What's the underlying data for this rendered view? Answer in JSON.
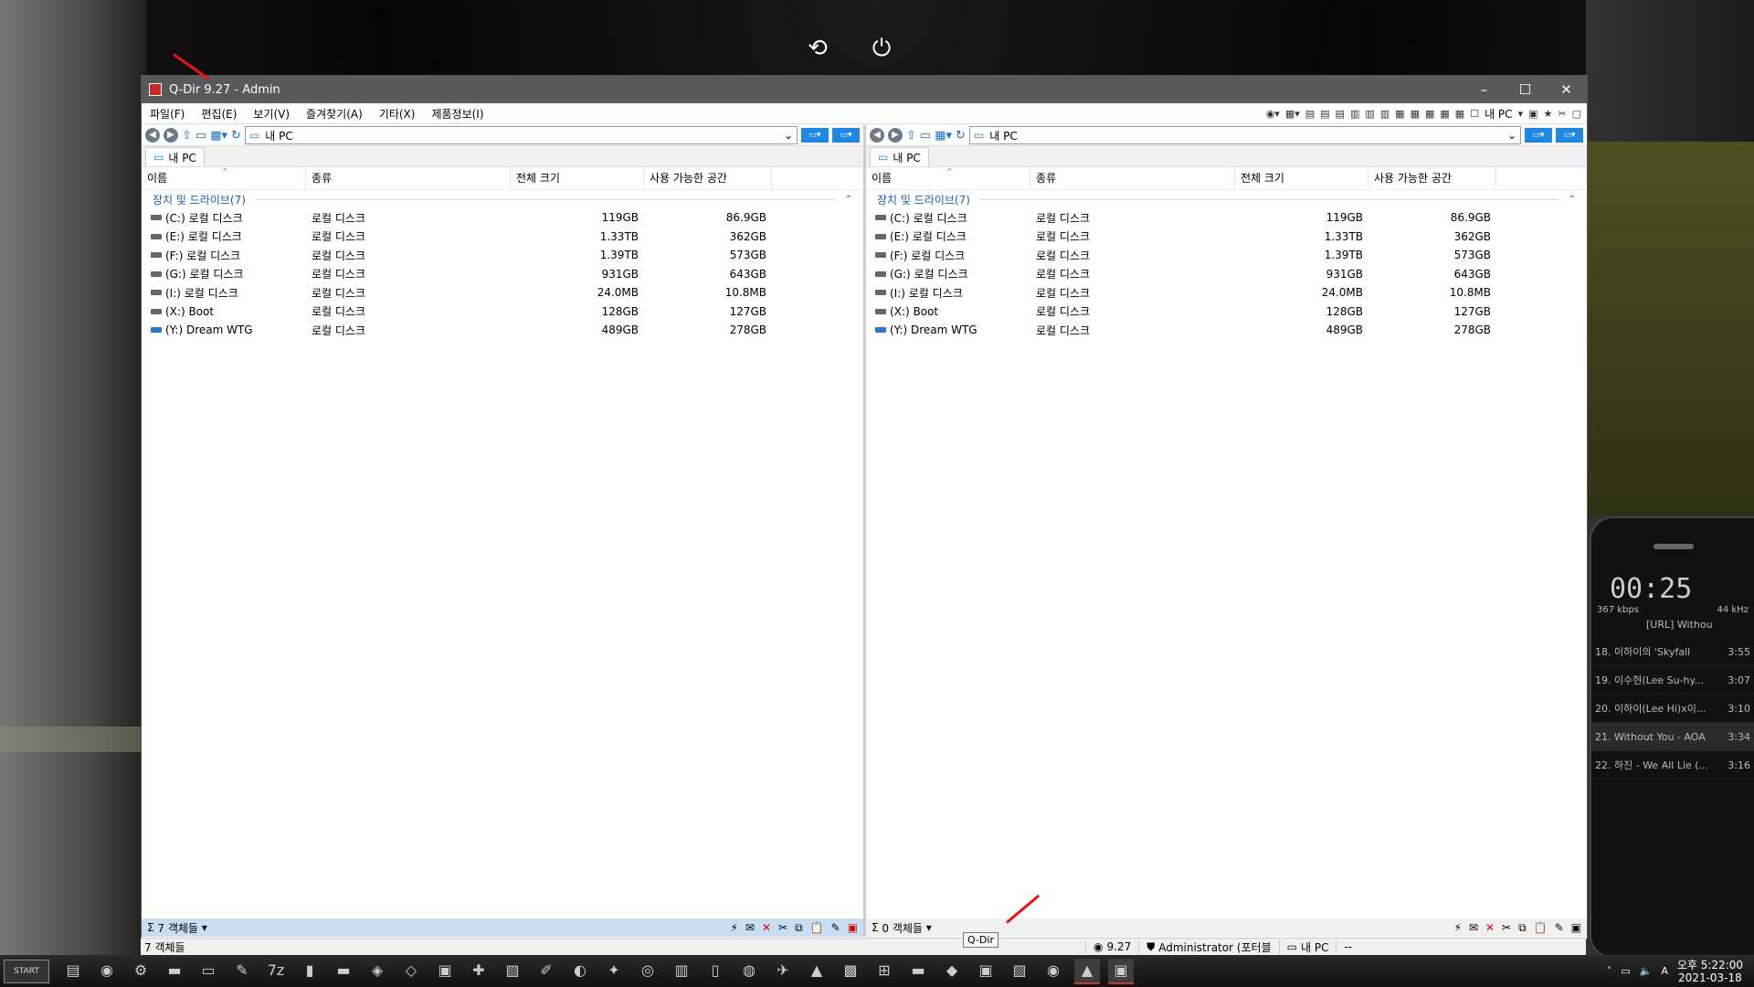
{
  "top_icons": {
    "restart": "⟲",
    "power": "⏻"
  },
  "window": {
    "title": "Q-Dir 9.27 - Admin",
    "controls": {
      "minimize": "–",
      "maximize": "☐",
      "close": "✕"
    },
    "menu": [
      "파일(F)",
      "편집(E)",
      "보기(V)",
      "즐겨찾기(A)",
      "기타(X)",
      "제품정보(I)"
    ],
    "menu_right_location": "내 PC"
  },
  "left_pane": {
    "address": "내 PC",
    "tab": "내 PC",
    "columns": [
      "이름",
      "종류",
      "전체 크기",
      "사용 가능한 공간"
    ],
    "group": "장치 및 드라이브(7)",
    "rows": [
      {
        "name": "(C:) 로컬 디스크",
        "type": "로컬 디스크",
        "total": "119GB",
        "free": "86.9GB"
      },
      {
        "name": "(E:) 로컬 디스크",
        "type": "로컬 디스크",
        "total": "1.33TB",
        "free": "362GB"
      },
      {
        "name": "(F:) 로컬 디스크",
        "type": "로컬 디스크",
        "total": "1.39TB",
        "free": "573GB"
      },
      {
        "name": "(G:) 로컬 디스크",
        "type": "로컬 디스크",
        "total": "931GB",
        "free": "643GB"
      },
      {
        "name": "(I:) 로컬 디스크",
        "type": "로컬 디스크",
        "total": "24.0MB",
        "free": "10.8MB"
      },
      {
        "name": "(X:) Boot",
        "type": "로컬 디스크",
        "total": "128GB",
        "free": "127GB"
      },
      {
        "name": "(Y:) Dream WTG",
        "type": "로컬 디스크",
        "total": "489GB",
        "free": "278GB"
      }
    ],
    "status": "7 객체들"
  },
  "right_pane": {
    "address": "내 PC",
    "tab": "내 PC",
    "columns": [
      "이름",
      "종류",
      "전체 크기",
      "사용 가능한 공간"
    ],
    "group": "장치 및 드라이브(7)",
    "rows": [
      {
        "name": "(C:) 로컬 디스크",
        "type": "로컬 디스크",
        "total": "119GB",
        "free": "86.9GB"
      },
      {
        "name": "(E:) 로컬 디스크",
        "type": "로컬 디스크",
        "total": "1.33TB",
        "free": "362GB"
      },
      {
        "name": "(F:) 로컬 디스크",
        "type": "로컬 디스크",
        "total": "1.39TB",
        "free": "573GB"
      },
      {
        "name": "(G:) 로컬 디스크",
        "type": "로컬 디스크",
        "total": "931GB",
        "free": "643GB"
      },
      {
        "name": "(I:) 로컬 디스크",
        "type": "로컬 디스크",
        "total": "24.0MB",
        "free": "10.8MB"
      },
      {
        "name": "(X:) Boot",
        "type": "로컬 디스크",
        "total": "128GB",
        "free": "127GB"
      },
      {
        "name": "(Y:) Dream WTG",
        "type": "로컬 디스크",
        "total": "489GB",
        "free": "278GB"
      }
    ],
    "status": "0 객체들"
  },
  "main_status": {
    "left": "7 객체들",
    "version": "9.27",
    "user": "Administrator (포터블",
    "location": "내 PC",
    "extra": "--"
  },
  "tooltip": "Q-Dir",
  "taskbar": {
    "start": "START",
    "time": "오후 5:22:00",
    "date": "2021-03-18",
    "ime": "A"
  },
  "player": {
    "time": "00:25",
    "kbps": "367 kbps",
    "khz": "44 kHz",
    "url": "[URL] Withou",
    "tracks": [
      {
        "title": "18. 이하이의 'Skyfall",
        "dur": "3:55"
      },
      {
        "title": "19. 이수현(Lee Su-hy...",
        "dur": "3:07"
      },
      {
        "title": "20. 이하이(Lee Hi)x이...",
        "dur": "3:10"
      },
      {
        "title": "21. Without You - AOA",
        "dur": "3:34"
      },
      {
        "title": "22. 하진 - We All Lie (...",
        "dur": "3:16"
      }
    ]
  },
  "colors": {
    "titlebar": "#595959",
    "accent": "#1e88e5",
    "status_active": "#c9def2"
  }
}
